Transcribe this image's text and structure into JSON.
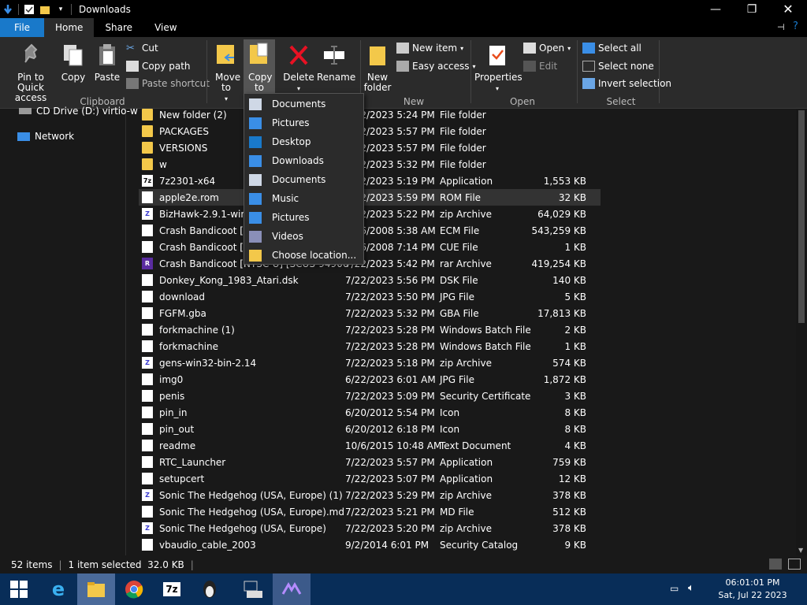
{
  "window": {
    "title": "Downloads"
  },
  "tabs": [
    {
      "label": "File"
    },
    {
      "label": "Home"
    },
    {
      "label": "Share"
    },
    {
      "label": "View"
    }
  ],
  "ribbon": {
    "clipboard": {
      "pin_label": "Pin to Quick access",
      "copy_label": "Copy",
      "paste_label": "Paste",
      "cut_label": "Cut",
      "copy_path_label": "Copy path",
      "paste_shortcut_label": "Paste shortcut",
      "group_label": "Clipboard"
    },
    "organize": {
      "move_to_label": "Move to",
      "copy_to_label": "Copy to",
      "delete_label": "Delete",
      "rename_label": "Rename"
    },
    "new": {
      "new_folder_label": "New folder",
      "new_item_label": "New item",
      "easy_access_label": "Easy access",
      "group_label": "New"
    },
    "open": {
      "properties_label": "Properties",
      "open_label": "Open",
      "edit_label": "Edit",
      "group_label": "Open"
    },
    "select": {
      "select_all_label": "Select all",
      "select_none_label": "Select none",
      "invert_label": "Invert selection",
      "group_label": "Select"
    }
  },
  "nav": {
    "items": [
      {
        "label": "CD Drive (D:) virtio-w"
      },
      {
        "label": "Network"
      }
    ]
  },
  "copy_to_menu": {
    "items": [
      {
        "label": "Documents"
      },
      {
        "label": "Pictures"
      },
      {
        "label": "Desktop"
      },
      {
        "label": "Downloads"
      },
      {
        "label": "Documents"
      },
      {
        "label": "Music"
      },
      {
        "label": "Pictures"
      },
      {
        "label": "Videos"
      },
      {
        "label": "Choose location..."
      }
    ]
  },
  "files": [
    {
      "name": "New folder (2)",
      "date": "7/22/2023 5:24 PM",
      "type": "File folder",
      "size": ""
    },
    {
      "name": "PACKAGES",
      "date": "7/22/2023 5:57 PM",
      "type": "File folder",
      "size": ""
    },
    {
      "name": "VERSIONS",
      "date": "7/22/2023 5:57 PM",
      "type": "File folder",
      "size": ""
    },
    {
      "name": "w",
      "date": "7/22/2023 5:32 PM",
      "type": "File folder",
      "size": ""
    },
    {
      "name": "7z2301-x64",
      "date": "7/22/2023 5:19 PM",
      "type": "Application",
      "size": "1,553 KB"
    },
    {
      "name": "apple2e.rom",
      "date": "7/22/2023 5:59 PM",
      "type": "ROM File",
      "size": "32 KB"
    },
    {
      "name": "BizHawk-2.9.1-win-x6",
      "date": "7/22/2023 5:22 PM",
      "type": "zip Archive",
      "size": "64,029 KB"
    },
    {
      "name": "Crash Bandicoot [NT",
      "date": "4/26/2008 5:38 AM",
      "type": "ECM File",
      "size": "543,259 KB"
    },
    {
      "name": "Crash Bandicoot [NT",
      "date": "4/26/2008 7:14 PM",
      "type": "CUE File",
      "size": "1 KB"
    },
    {
      "name": "Crash Bandicoot [NTSC-U] [SCUS-94900]",
      "date": "7/22/2023 5:42 PM",
      "type": "rar Archive",
      "size": "419,254 KB"
    },
    {
      "name": "Donkey_Kong_1983_Atari.dsk",
      "date": "7/22/2023 5:56 PM",
      "type": "DSK File",
      "size": "140 KB"
    },
    {
      "name": "download",
      "date": "7/22/2023 5:50 PM",
      "type": "JPG File",
      "size": "5 KB"
    },
    {
      "name": "FGFM.gba",
      "date": "7/22/2023 5:32 PM",
      "type": "GBA File",
      "size": "17,813 KB"
    },
    {
      "name": "forkmachine (1)",
      "date": "7/22/2023 5:28 PM",
      "type": "Windows Batch File",
      "size": "2 KB"
    },
    {
      "name": "forkmachine",
      "date": "7/22/2023 5:28 PM",
      "type": "Windows Batch File",
      "size": "1 KB"
    },
    {
      "name": "gens-win32-bin-2.14",
      "date": "7/22/2023 5:18 PM",
      "type": "zip Archive",
      "size": "574 KB"
    },
    {
      "name": "img0",
      "date": "6/22/2023 6:01 AM",
      "type": "JPG File",
      "size": "1,872 KB"
    },
    {
      "name": "penis",
      "date": "7/22/2023 5:09 PM",
      "type": "Security Certificate",
      "size": "3 KB"
    },
    {
      "name": "pin_in",
      "date": "6/20/2012 5:54 PM",
      "type": "Icon",
      "size": "8 KB"
    },
    {
      "name": "pin_out",
      "date": "6/20/2012 6:18 PM",
      "type": "Icon",
      "size": "8 KB"
    },
    {
      "name": "readme",
      "date": "10/6/2015 10:48 AM",
      "type": "Text Document",
      "size": "4 KB"
    },
    {
      "name": "RTC_Launcher",
      "date": "7/22/2023 5:57 PM",
      "type": "Application",
      "size": "759 KB"
    },
    {
      "name": "setupcert",
      "date": "7/22/2023 5:07 PM",
      "type": "Application",
      "size": "12 KB"
    },
    {
      "name": "Sonic The Hedgehog (USA, Europe) (1)",
      "date": "7/22/2023 5:29 PM",
      "type": "zip Archive",
      "size": "378 KB"
    },
    {
      "name": "Sonic The Hedgehog (USA, Europe).md",
      "date": "7/22/2023 5:21 PM",
      "type": "MD File",
      "size": "512 KB"
    },
    {
      "name": "Sonic The Hedgehog (USA, Europe)",
      "date": "7/22/2023 5:20 PM",
      "type": "zip Archive",
      "size": "378 KB"
    },
    {
      "name": "vbaudio_cable_2003",
      "date": "9/2/2014 6:01 PM",
      "type": "Security Catalog",
      "size": "9 KB"
    }
  ],
  "status": {
    "items_count": "52 items",
    "selected": "1 item selected  32.0 KB"
  },
  "taskbar": {
    "time": "06:01:01 PM",
    "date": "Sat, Jul 22 2023"
  },
  "colors": {
    "accent": "#1979ca",
    "folder": "#f3c84a",
    "taskbar": "#082d58"
  }
}
